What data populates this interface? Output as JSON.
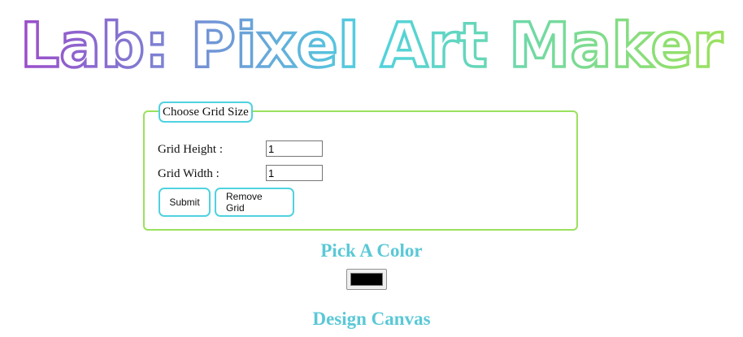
{
  "page": {
    "title": "Lab: Pixel Art Maker",
    "title_gradient": [
      "#9b4dca",
      "#4fd2e0",
      "#9be15d"
    ]
  },
  "grid_form": {
    "legend": "Choose Grid Size",
    "height_label": "Grid Height :",
    "height_value": "1",
    "width_label": "Grid Width :",
    "width_value": "1",
    "submit_label": "Submit",
    "remove_label": "Remove Grid"
  },
  "color_picker": {
    "heading": "Pick A Color",
    "value": "#000000"
  },
  "canvas": {
    "heading": "Design Canvas"
  }
}
